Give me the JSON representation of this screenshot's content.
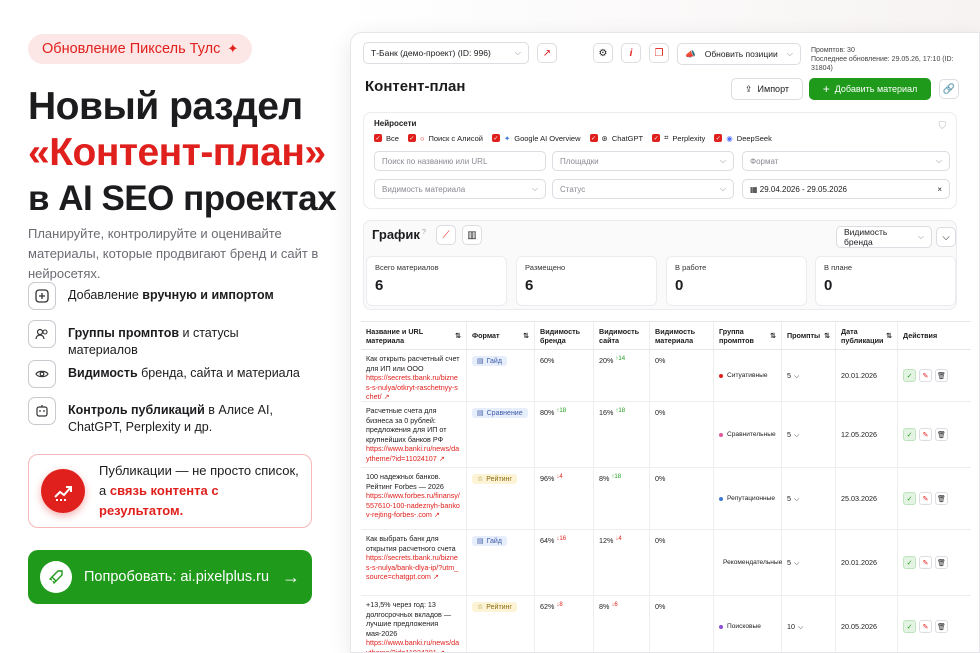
{
  "promo": {
    "pill": "Обновление Пиксель Тулс",
    "headline_1": "Новый раздел",
    "headline_2": "«Контент-план»",
    "headline_3": "в AI SEO проектах",
    "subtitle": "Планируйте, контролируйте и оценивайте материалы, которые продвигают бренд и сайт в нейросетях.",
    "features": [
      {
        "icon": "plus-square-icon",
        "pre": "Добавление ",
        "bold": "вручную и импортом",
        "post": ""
      },
      {
        "icon": "users-icon",
        "pre": "",
        "bold": "Группы промптов",
        "post": " и статусы материалов"
      },
      {
        "icon": "eye-icon",
        "pre": "",
        "bold": "Видимость",
        "post": " бренда, сайта и материала"
      },
      {
        "icon": "bot-icon",
        "pre": "",
        "bold": "Контроль публикаций",
        "post": " в Алисе AI, ChatGPT, Perplexity и др."
      }
    ],
    "callout_1": "Публикации — не просто список,",
    "callout_2_pre": "а ",
    "callout_2_red": "связь контента с результатом.",
    "cta": "Попробовать: ai.pixelplus.ru"
  },
  "app": {
    "project": "Т-Банк (демо-проект) (ID: 996)",
    "update_button": "Обновить позиции",
    "prompts_count": "Промптов: 30",
    "last_update": "Последнее обновление: 29.05.26, 17:10 (ID: 31804)",
    "page_title": "Контент-план",
    "import_button": "Импорт",
    "add_button": "Добавить материал",
    "filters": {
      "label": "Нейросети",
      "chips": [
        "Все",
        "Поиск с Алисой",
        "Google AI Overview",
        "ChatGPT",
        "Perplexity",
        "DeepSeek"
      ],
      "search_placeholder": "Поиск по названию или URL",
      "platforms": "Площадки",
      "format": "Формат",
      "visibility": "Видимость материала",
      "status": "Статус",
      "date_range": "29.04.2026 - 29.05.2026"
    },
    "graph": {
      "title": "График",
      "help": "?",
      "mode_select": "Видимость бренда",
      "stats": [
        {
          "label": "Всего материалов",
          "value": "6"
        },
        {
          "label": "Размещено",
          "value": "6"
        },
        {
          "label": "В работе",
          "value": "0"
        },
        {
          "label": "В плане",
          "value": "0"
        }
      ]
    },
    "table": {
      "headers": [
        "Название и URL материала",
        "Формат",
        "Видимость бренда",
        "Видимость сайта",
        "Видимость материала",
        "Группа промптов",
        "Промпты",
        "Дата публикации",
        "Действия"
      ],
      "rows": [
        {
          "title": "Как открыть расчетный счет для ИП или ООО",
          "url": "https://secrets.tbank.ru/biznes-s-nulya/otkryt-raschetnyy-schet/",
          "format": "Гайд",
          "format_color": "blue",
          "brand": "60%",
          "brand_delta": "",
          "brand_dir": "",
          "site": "20%",
          "site_delta": "14",
          "site_dir": "up",
          "material": "0%",
          "group": "Ситуативные",
          "group_color": "#e0201c",
          "prompts": "5",
          "date": "20.01.2026"
        },
        {
          "title": "Расчетные счета для бизнеса за 0 рублей: предложения для ИП от крупнейших банков РФ",
          "url": "https://www.banki.ru/news/daytheme/?id=11024107",
          "format": "Сравнение",
          "format_color": "blue",
          "brand": "80%",
          "brand_delta": "18",
          "brand_dir": "up",
          "site": "16%",
          "site_delta": "18",
          "site_dir": "up",
          "material": "0%",
          "group": "Сравнительные",
          "group_color": "#e05a9a",
          "prompts": "5",
          "date": "12.05.2026"
        },
        {
          "title": "100 надежных банков. Рейтинг Forbes — 2026",
          "url": "https://www.forbes.ru/finansy/557610-100-nadeznyh-bankov-rejting-forbes-.com",
          "format": "Рейтинг",
          "format_color": "yel",
          "brand": "96%",
          "brand_delta": "4",
          "brand_dir": "dn",
          "site": "8%",
          "site_delta": "18",
          "site_dir": "up",
          "material": "0%",
          "group": "Репутационные",
          "group_color": "#3e7bd6",
          "prompts": "5",
          "date": "25.03.2026"
        },
        {
          "title": "Как выбрать банк для открытия расчетного счета",
          "url": "https://secrets.tbank.ru/biznes-s-nulya/bank-dlya-ip/?utm_source=chatgpt.com",
          "format": "Гайд",
          "format_color": "blue",
          "brand": "64%",
          "brand_delta": "16",
          "brand_dir": "dn",
          "site": "12%",
          "site_delta": "4",
          "site_dir": "dn",
          "material": "0%",
          "group": "Рекомендательные",
          "group_color": "#1fb8c4",
          "prompts": "5",
          "date": "20.01.2026"
        },
        {
          "title": "+13,5% через год: 13 долгосрочных вкладов — лучшие предложения мая-2026",
          "url": "https://www.banki.ru/news/daytheme/?id=11024301",
          "format": "Рейтинг",
          "format_color": "yel",
          "brand": "62%",
          "brand_delta": "8",
          "brand_dir": "dn",
          "site": "8%",
          "site_delta": "6",
          "site_dir": "dn",
          "material": "0%",
          "group": "Поисковые",
          "group_color": "#8a4fd6",
          "prompts": "10",
          "date": "20.05.2026"
        }
      ]
    }
  }
}
